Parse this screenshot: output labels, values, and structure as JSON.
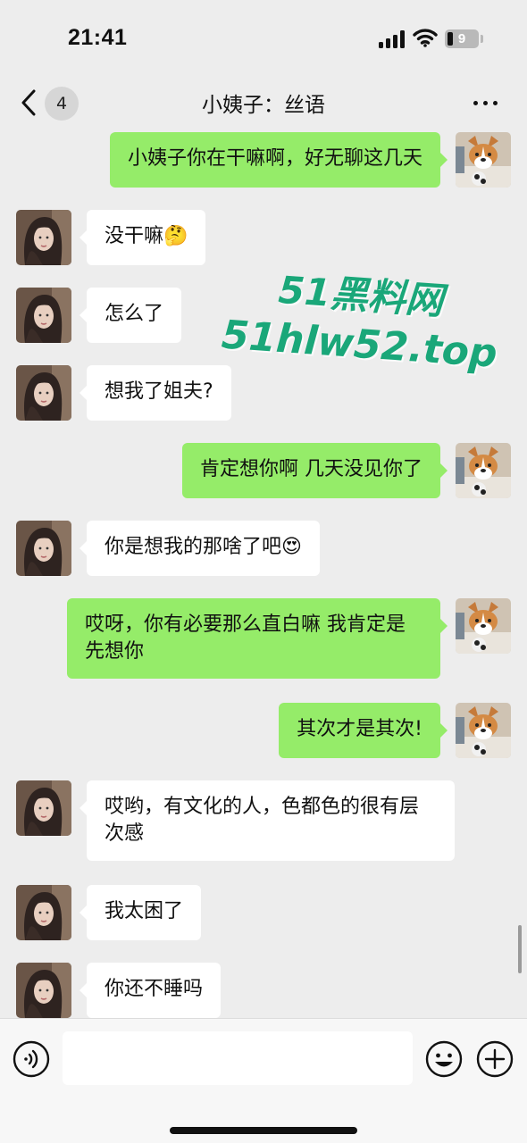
{
  "status_bar": {
    "time": "21:41",
    "battery_level": "9"
  },
  "nav": {
    "unread_count": "4",
    "title": "小姨子：丝语"
  },
  "messages": [
    {
      "from": "me",
      "text": "小姨子你在干嘛啊，好无聊这几天"
    },
    {
      "from": "her",
      "text": "没干嘛🤔"
    },
    {
      "from": "her",
      "text": "怎么了"
    },
    {
      "from": "her",
      "text": "想我了姐夫?"
    },
    {
      "from": "me",
      "text": "肯定想你啊 几天没见你了"
    },
    {
      "from": "her",
      "text": "你是想我的那啥了吧😍"
    },
    {
      "from": "me",
      "text": "哎呀，你有必要那么直白嘛 我肯定是先想你"
    },
    {
      "from": "me",
      "text": "其次才是其次!"
    },
    {
      "from": "her",
      "text": "哎哟，有文化的人，色都色的很有层次感"
    },
    {
      "from": "her",
      "text": "我太困了"
    },
    {
      "from": "her",
      "text": "你还不睡吗"
    }
  ],
  "watermark": {
    "line1": "51黑料网",
    "line2": "51hlw52.top"
  },
  "input_bar": {
    "placeholder": ""
  },
  "icons": {
    "back": "chevron-left-icon",
    "more": "more-dots-icon",
    "voice": "voice-icon",
    "emoji": "emoji-icon",
    "plus": "plus-icon"
  },
  "colors": {
    "outgoing_bubble": "#95ec69",
    "incoming_bubble": "#ffffff",
    "background": "#ededed",
    "watermark": "#1aa779"
  }
}
